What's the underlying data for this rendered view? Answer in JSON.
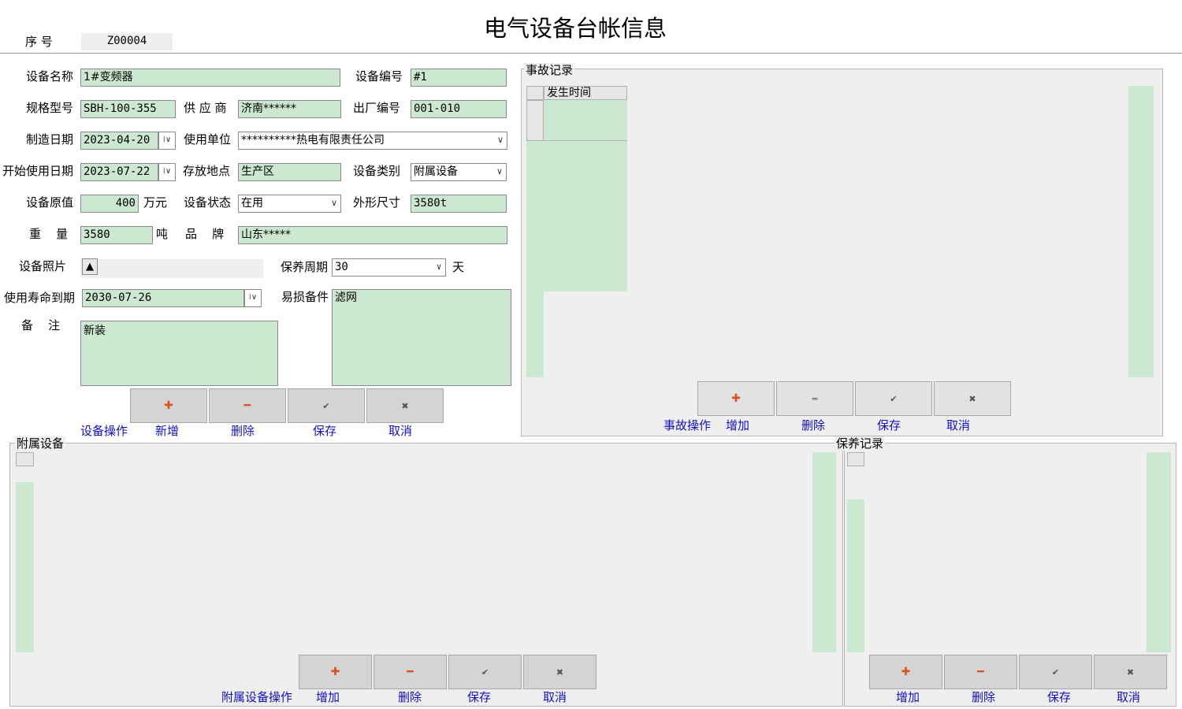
{
  "title": "电气设备台帐信息",
  "serial": {
    "label": "序  号",
    "value": "Z00004"
  },
  "form": {
    "name_label": "设备名称",
    "name": "1#变频器",
    "code_label": "设备编号",
    "code": "#1",
    "model_label": "规格型号",
    "model": "SBH-100-355",
    "supplier_label": "供 应 商",
    "supplier": "济南******",
    "factory_no_label": "出厂编号",
    "factory_no": "001-010",
    "mfg_date_label": "制造日期",
    "mfg_date": "2023-04-20",
    "unit_label": "使用单位",
    "unit": "**********热电有限责任公司",
    "start_date_label": "开始使用日期",
    "start_date": "2023-07-22",
    "location_label": "存放地点",
    "location": "生产区",
    "category_label": "设备类别",
    "category": "附属设备",
    "value_label": "设备原值",
    "value": "400",
    "value_unit": "万元",
    "status_label": "设备状态",
    "status": "在用",
    "size_label": "外形尺寸",
    "size": "3580t",
    "weight_label": "重    量",
    "weight": "3580",
    "weight_unit": "吨",
    "brand_label": "品    牌",
    "brand": "山东*****",
    "photo_label": "设备照片",
    "maint_cycle_label": "保养周期",
    "maint_cycle": "30",
    "maint_cycle_unit": "天",
    "life_end_label": "使用寿命到期",
    "life_end": "2030-07-26",
    "spares_label": "易损备件",
    "spares": "滤网",
    "remarks_label": "备    注",
    "remarks": "新装"
  },
  "device_ops": {
    "label": "设备操作",
    "add": "新增",
    "delete": "删除",
    "save": "保存",
    "cancel": "取消"
  },
  "accident": {
    "title": "事故记录",
    "column": "发生时间",
    "ops_label": "事故操作",
    "add": "增加",
    "delete": "删除",
    "save": "保存",
    "cancel": "取消"
  },
  "attached": {
    "title": "附属设备",
    "ops_label": "附属设备操作",
    "add": "增加",
    "delete": "删除",
    "save": "保存",
    "cancel": "取消"
  },
  "maintenance": {
    "title": "保养记录",
    "add": "增加",
    "delete": "删除",
    "save": "保存",
    "cancel": "取消"
  },
  "icons": {
    "add": "plus-icon",
    "delete": "minus-icon",
    "save": "check-icon",
    "cancel": "x-icon"
  },
  "colors": {
    "field_bg": "#cde8d0",
    "link_blue": "#1010c8",
    "icon_orange": "#d8541a",
    "panel_bg": "#efefef"
  }
}
